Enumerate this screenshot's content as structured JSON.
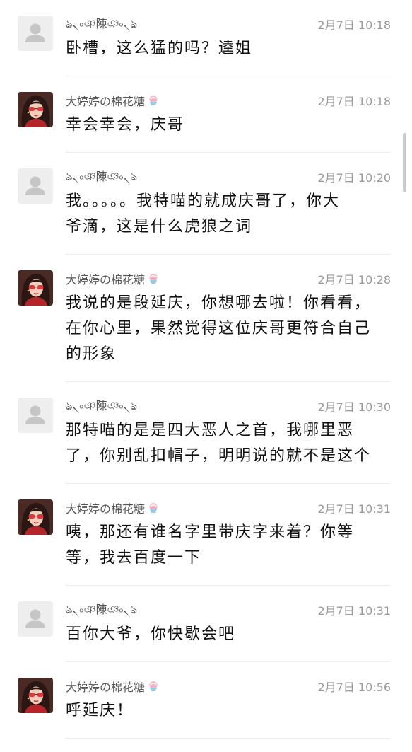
{
  "comments": [
    {
      "user": "ঌ৲৹ঞ陳ঞ৹৲ঌ",
      "avatar": "default-avatar",
      "time": "2月7日 10:18",
      "lines": [
        "卧槽，这么猛的吗？逵姐"
      ]
    },
    {
      "user": "大婷婷の棉花糖",
      "user_icon": "cotton-candy-icon",
      "avatar": "photo-avatar",
      "time": "2月7日 10:18",
      "lines": [
        "幸会幸会，庆哥"
      ]
    },
    {
      "user": "ঌ৲৹ঞ陳ঞ৹৲ঌ",
      "avatar": "default-avatar",
      "time": "2月7日 10:20",
      "lines": [
        "我。。。。。我特喵的就成庆哥了，你大",
        "爷滴，这是什么虎狼之词"
      ]
    },
    {
      "user": "大婷婷の棉花糖",
      "user_icon": "cotton-candy-icon",
      "avatar": "photo-avatar",
      "time": "2月7日 10:28",
      "lines": [
        "我说的是段延庆，你想哪去啦！你看看，",
        "在你心里，果然觉得这位庆哥更符合自己",
        "的形象"
      ]
    },
    {
      "user": "ঌ৲৹ঞ陳ঞ৹৲ঌ",
      "avatar": "default-avatar",
      "time": "2月7日 10:30",
      "lines": [
        "那特喵的是是四大恶人之首，我哪里恶",
        "了，你别乱扣帽子，明明说的就不是这个"
      ]
    },
    {
      "user": "大婷婷の棉花糖",
      "user_icon": "cotton-candy-icon",
      "avatar": "photo-avatar",
      "time": "2月7日 10:31",
      "lines": [
        "咦，那还有谁名字里带庆字来着？你等",
        "等，我去百度一下"
      ]
    },
    {
      "user": "ঌ৲৹ঞ陳ঞ৹৲ঌ",
      "avatar": "default-avatar",
      "time": "2月7日 10:31",
      "lines": [
        "百你大爷，你快歇会吧"
      ]
    },
    {
      "user": "大婷婷の棉花糖",
      "user_icon": "cotton-candy-icon",
      "avatar": "photo-avatar",
      "time": "2月7日 10:56",
      "lines": [
        "呼延庆！"
      ]
    }
  ],
  "colors": {
    "message_text": "#111111",
    "username": "#555555",
    "timestamp": "#9a9a9a",
    "divider": "#ededed",
    "avatar_placeholder_bg": "#eeeeee",
    "avatar_placeholder_figure": "#c6c6c6"
  }
}
